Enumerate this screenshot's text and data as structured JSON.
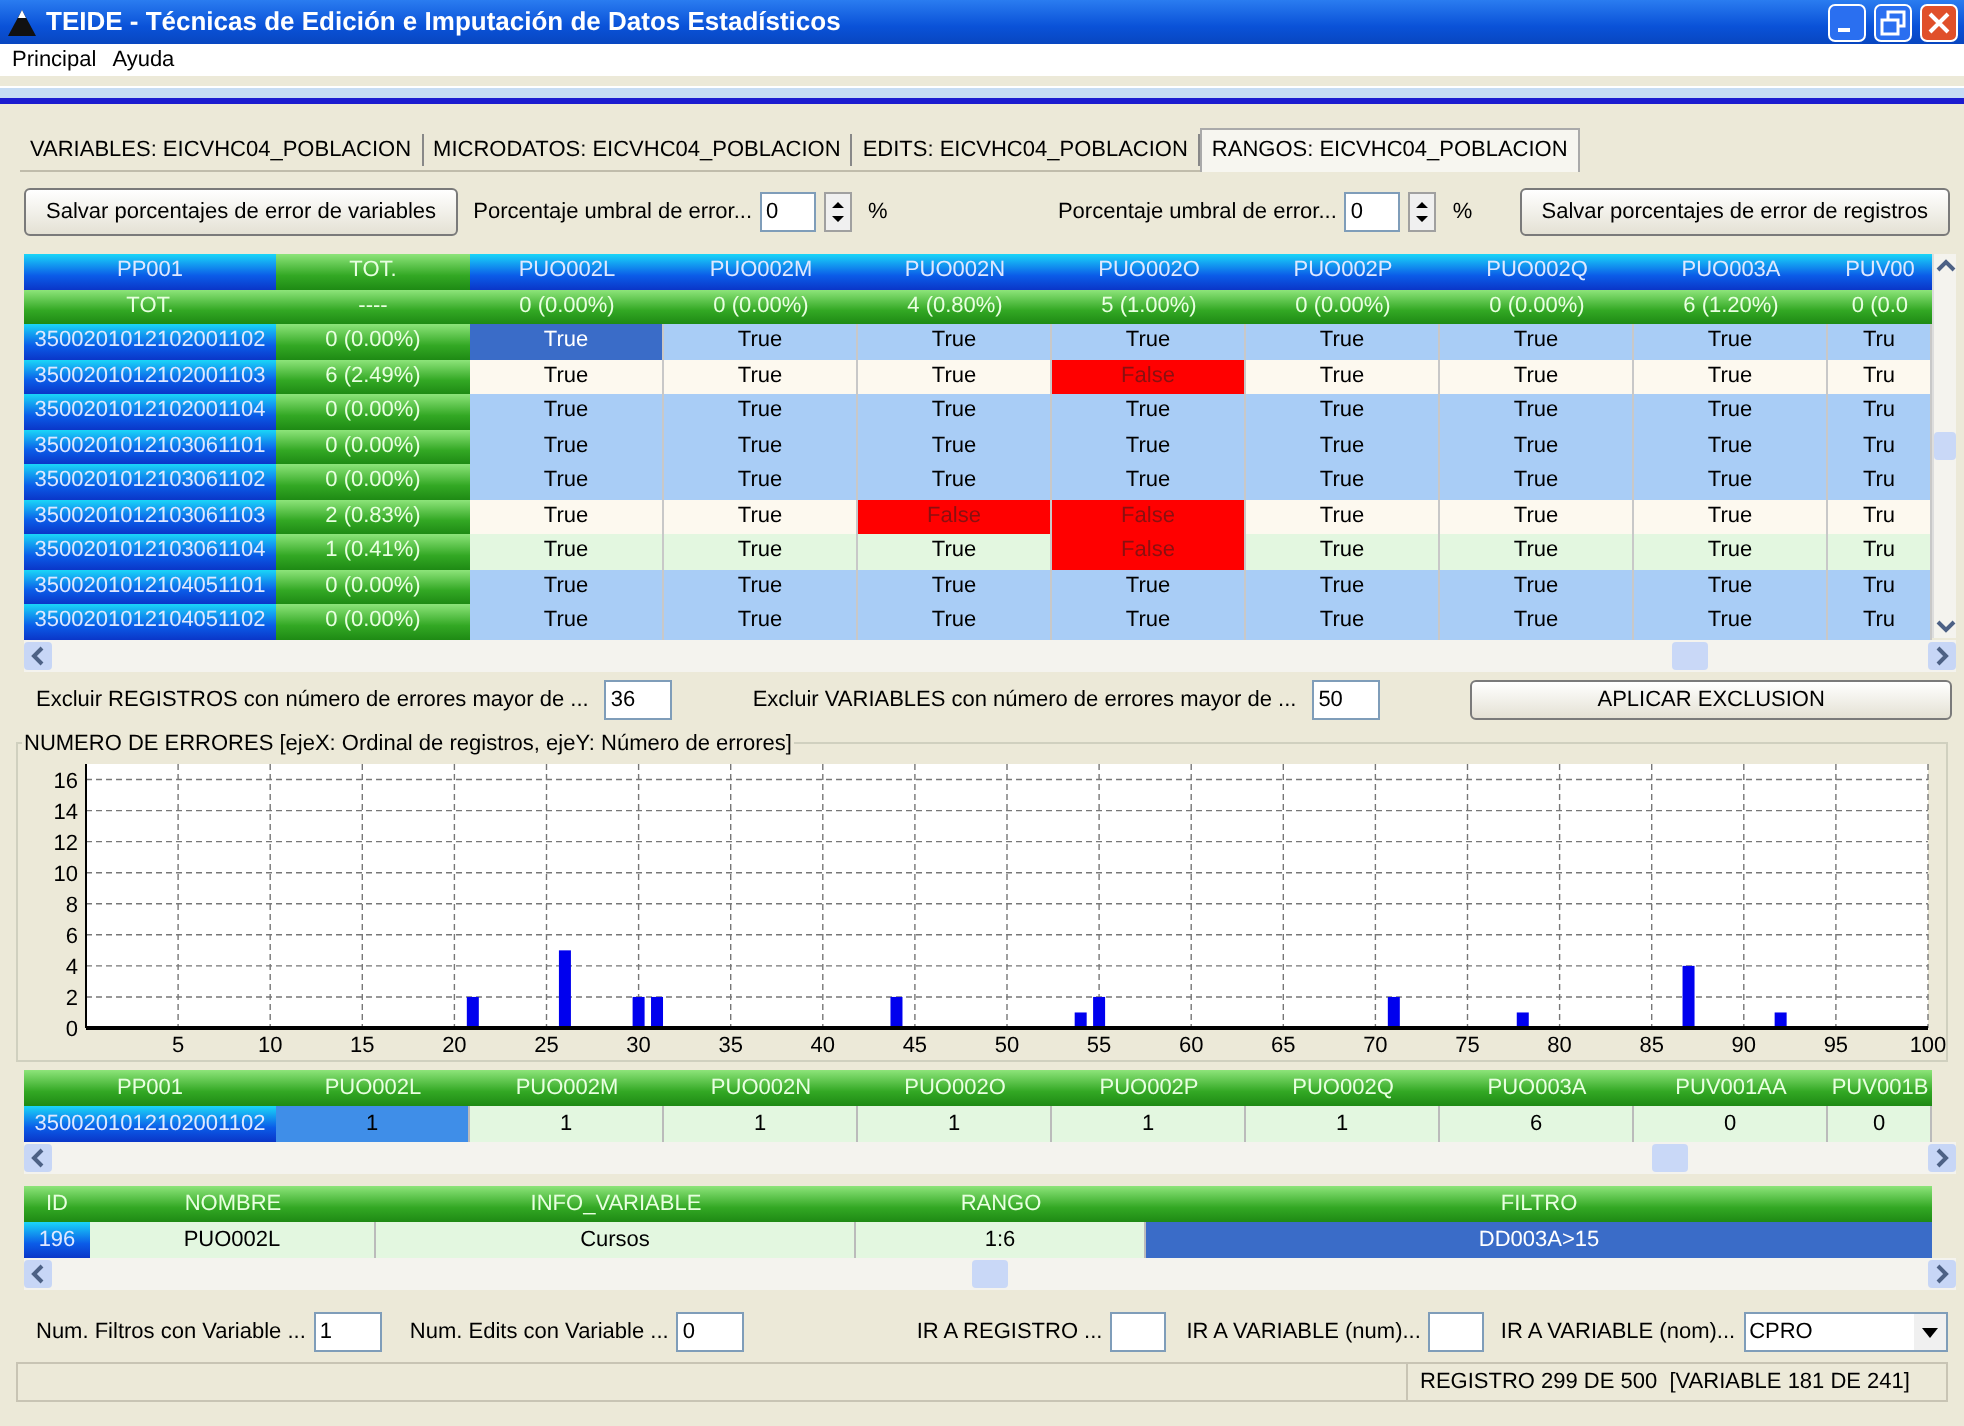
{
  "window": {
    "title": "TEIDE - Técnicas de Edición e Imputación de Datos Estadísticos"
  },
  "menu": [
    "Principal",
    "Ayuda"
  ],
  "tabs": [
    {
      "label": "VARIABLES: EICVHC04_POBLACION",
      "selected": false
    },
    {
      "label": "MICRODATOS: EICVHC04_POBLACION",
      "selected": false
    },
    {
      "label": "EDITS: EICVHC04_POBLACION",
      "selected": false
    },
    {
      "label": "RANGOS: EICVHC04_POBLACION",
      "selected": true
    }
  ],
  "toolbar": {
    "save_variables_button": "Salvar porcentajes de error de variables",
    "thresholds": [
      {
        "label": "Porcentaje umbral de error...",
        "value": "0",
        "unit": "%"
      },
      {
        "label": "Porcentaje umbral de error...",
        "value": "0",
        "unit": "%"
      }
    ],
    "save_records_button": "Salvar porcentajes de error de registros"
  },
  "grid": {
    "columns": {
      "pp001": "PP001",
      "tot": "TOT.",
      "variables": [
        "PUO002L",
        "PUO002M",
        "PUO002N",
        "PUO002O",
        "PUO002P",
        "PUO002Q",
        "PUO003A",
        "PUV00"
      ]
    },
    "totals": {
      "pp001": "TOT.",
      "tot": "----",
      "variables": [
        "0 (0.00%)",
        "0 (0.00%)",
        "4 (0.80%)",
        "5 (1.00%)",
        "0 (0.00%)",
        "0 (0.00%)",
        "6 (1.20%)",
        "0 (0.0"
      ]
    },
    "rows": [
      {
        "pp001": "3500201012102001102",
        "tot": "0 (0.00%)",
        "color": "#a9cdf6",
        "variables": [
          {
            "value": "True",
            "selected": true,
            "error": false
          },
          {
            "value": "True",
            "selected": false,
            "error": false
          },
          {
            "value": "True",
            "selected": false,
            "error": false
          },
          {
            "value": "True",
            "selected": false,
            "error": false
          },
          {
            "value": "True",
            "selected": false,
            "error": false
          },
          {
            "value": "True",
            "selected": false,
            "error": false
          },
          {
            "value": "True",
            "selected": false,
            "error": false
          },
          {
            "value": "Tru",
            "selected": false,
            "error": false
          }
        ]
      },
      {
        "pp001": "3500201012102001103",
        "tot": "6 (2.49%)",
        "color": "#fdf9ef",
        "variables": [
          {
            "value": "True",
            "selected": false,
            "error": false
          },
          {
            "value": "True",
            "selected": false,
            "error": false
          },
          {
            "value": "True",
            "selected": false,
            "error": false
          },
          {
            "value": "False",
            "selected": false,
            "error": true
          },
          {
            "value": "True",
            "selected": false,
            "error": false
          },
          {
            "value": "True",
            "selected": false,
            "error": false
          },
          {
            "value": "True",
            "selected": false,
            "error": false
          },
          {
            "value": "Tru",
            "selected": false,
            "error": false
          }
        ]
      },
      {
        "pp001": "3500201012102001104",
        "tot": "0 (0.00%)",
        "color": "#a9cdf6",
        "variables": [
          {
            "value": "True",
            "selected": false,
            "error": false
          },
          {
            "value": "True",
            "selected": false,
            "error": false
          },
          {
            "value": "True",
            "selected": false,
            "error": false
          },
          {
            "value": "True",
            "selected": false,
            "error": false
          },
          {
            "value": "True",
            "selected": false,
            "error": false
          },
          {
            "value": "True",
            "selected": false,
            "error": false
          },
          {
            "value": "True",
            "selected": false,
            "error": false
          },
          {
            "value": "Tru",
            "selected": false,
            "error": false
          }
        ]
      },
      {
        "pp001": "3500201012103061101",
        "tot": "0 (0.00%)",
        "color": "#a9cdf6",
        "variables": [
          {
            "value": "True",
            "selected": false,
            "error": false
          },
          {
            "value": "True",
            "selected": false,
            "error": false
          },
          {
            "value": "True",
            "selected": false,
            "error": false
          },
          {
            "value": "True",
            "selected": false,
            "error": false
          },
          {
            "value": "True",
            "selected": false,
            "error": false
          },
          {
            "value": "True",
            "selected": false,
            "error": false
          },
          {
            "value": "True",
            "selected": false,
            "error": false
          },
          {
            "value": "Tru",
            "selected": false,
            "error": false
          }
        ]
      },
      {
        "pp001": "3500201012103061102",
        "tot": "0 (0.00%)",
        "color": "#a9cdf6",
        "variables": [
          {
            "value": "True",
            "selected": false,
            "error": false
          },
          {
            "value": "True",
            "selected": false,
            "error": false
          },
          {
            "value": "True",
            "selected": false,
            "error": false
          },
          {
            "value": "True",
            "selected": false,
            "error": false
          },
          {
            "value": "True",
            "selected": false,
            "error": false
          },
          {
            "value": "True",
            "selected": false,
            "error": false
          },
          {
            "value": "True",
            "selected": false,
            "error": false
          },
          {
            "value": "Tru",
            "selected": false,
            "error": false
          }
        ]
      },
      {
        "pp001": "3500201012103061103",
        "tot": "2 (0.83%)",
        "color": "#fdf9ef",
        "variables": [
          {
            "value": "True",
            "selected": false,
            "error": false
          },
          {
            "value": "True",
            "selected": false,
            "error": false
          },
          {
            "value": "False",
            "selected": false,
            "error": true
          },
          {
            "value": "False",
            "selected": false,
            "error": true
          },
          {
            "value": "True",
            "selected": false,
            "error": false
          },
          {
            "value": "True",
            "selected": false,
            "error": false
          },
          {
            "value": "True",
            "selected": false,
            "error": false
          },
          {
            "value": "Tru",
            "selected": false,
            "error": false
          }
        ]
      },
      {
        "pp001": "3500201012103061104",
        "tot": "1 (0.41%)",
        "color": "#e3f7e0",
        "variables": [
          {
            "value": "True",
            "selected": false,
            "error": false
          },
          {
            "value": "True",
            "selected": false,
            "error": false
          },
          {
            "value": "True",
            "selected": false,
            "error": false
          },
          {
            "value": "False",
            "selected": false,
            "error": true
          },
          {
            "value": "True",
            "selected": false,
            "error": false
          },
          {
            "value": "True",
            "selected": false,
            "error": false
          },
          {
            "value": "True",
            "selected": false,
            "error": false
          },
          {
            "value": "Tru",
            "selected": false,
            "error": false
          }
        ]
      },
      {
        "pp001": "3500201012104051101",
        "tot": "0 (0.00%)",
        "color": "#a9cdf6",
        "variables": [
          {
            "value": "True",
            "selected": false,
            "error": false
          },
          {
            "value": "True",
            "selected": false,
            "error": false
          },
          {
            "value": "True",
            "selected": false,
            "error": false
          },
          {
            "value": "True",
            "selected": false,
            "error": false
          },
          {
            "value": "True",
            "selected": false,
            "error": false
          },
          {
            "value": "True",
            "selected": false,
            "error": false
          },
          {
            "value": "True",
            "selected": false,
            "error": false
          },
          {
            "value": "Tru",
            "selected": false,
            "error": false
          }
        ]
      },
      {
        "pp001": "3500201012104051102",
        "tot": "0 (0.00%)",
        "color": "#a9cdf6",
        "variables": [
          {
            "value": "True",
            "selected": false,
            "error": false
          },
          {
            "value": "True",
            "selected": false,
            "error": false
          },
          {
            "value": "True",
            "selected": false,
            "error": false
          },
          {
            "value": "True",
            "selected": false,
            "error": false
          },
          {
            "value": "True",
            "selected": false,
            "error": false
          },
          {
            "value": "True",
            "selected": false,
            "error": false
          },
          {
            "value": "True",
            "selected": false,
            "error": false
          },
          {
            "value": "Tru",
            "selected": false,
            "error": false
          }
        ]
      }
    ]
  },
  "exclusion": {
    "fields": [
      {
        "label": "Excluir REGISTROS con número de errores mayor de ...",
        "value": "36"
      },
      {
        "label": "Excluir VARIABLES con número de errores mayor de ...",
        "value": "50"
      }
    ],
    "button": "APLICAR EXCLUSION"
  },
  "chart_panel": {
    "title": "NUMERO DE ERRORES [ejeX: Ordinal de registros, ejeY: Número de errores]",
    "chart_data": {
      "type": "bar",
      "x": [
        21,
        26,
        30,
        31,
        44,
        54,
        55,
        71,
        78,
        87,
        92
      ],
      "series": [
        {
          "color": "#0000ee",
          "values": [
            2,
            5,
            2,
            2,
            2,
            1,
            2,
            2,
            1,
            4,
            1
          ]
        }
      ],
      "xlim": [
        0,
        100
      ],
      "ylim": [
        0,
        17
      ],
      "grid": true,
      "xticks": [
        5,
        10,
        15,
        20,
        25,
        30,
        35,
        40,
        45,
        50,
        55,
        60,
        65,
        70,
        75,
        80,
        85,
        90,
        95,
        100
      ],
      "yticks": [
        0,
        2,
        4,
        6,
        8,
        10,
        12,
        14,
        16
      ]
    }
  },
  "record_table": {
    "columns": [
      "PP001",
      "PUO002L",
      "PUO002M",
      "PUO002N",
      "PUO002O",
      "PUO002P",
      "PUO002Q",
      "PUO003A",
      "PUV001AA",
      "PUV001B"
    ],
    "rows": [
      {
        "cells": [
          "3500201012102001102",
          "1",
          "1",
          "1",
          "1",
          "1",
          "1",
          "6",
          "0",
          "0"
        ]
      }
    ]
  },
  "variable_table": {
    "columns": [
      "ID",
      "NOMBRE",
      "INFO_VARIABLE",
      "RANGO",
      "FILTRO"
    ],
    "rows": [
      {
        "cells": [
          {
            "value": "196",
            "selected": false
          },
          {
            "value": "PUO002L",
            "selected": false
          },
          {
            "value": "Cursos",
            "selected": false
          },
          {
            "value": "1:6",
            "selected": false
          },
          {
            "value": "DD003A>15",
            "selected": true
          }
        ]
      }
    ]
  },
  "footer": {
    "fields": [
      {
        "label": "Num. Filtros con Variable ...",
        "value": "1"
      },
      {
        "label": "Num. Edits con Variable ...",
        "value": "0"
      },
      {
        "label": "IR A REGISTRO ..."
      },
      {
        "label": "IR A VARIABLE (num)..."
      }
    ],
    "select": {
      "label": "IR A VARIABLE (nom)...",
      "value": "CPRO"
    }
  },
  "status_bar": "REGISTRO 299 DE 500  [VARIABLE 181 DE 241]"
}
